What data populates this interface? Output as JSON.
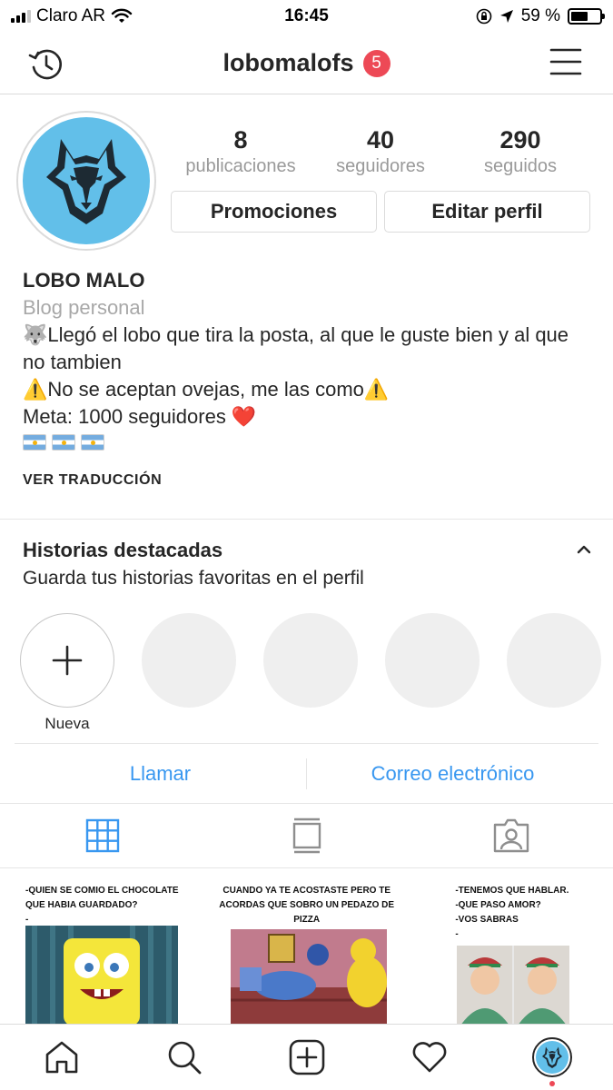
{
  "status_bar": {
    "carrier": "Claro AR",
    "time": "16:45",
    "battery_percent": "59 %",
    "battery_level": 0.59
  },
  "top_nav": {
    "username": "lobomalofs",
    "notification_count": "5",
    "left_icon": "history-icon",
    "right_icon": "menu-icon"
  },
  "profile": {
    "stats": [
      {
        "value": "8",
        "label": "publicaciones"
      },
      {
        "value": "40",
        "label": "seguidores"
      },
      {
        "value": "290",
        "label": "seguidos"
      }
    ],
    "buttons": {
      "promotions": "Promociones",
      "edit": "Editar perfil"
    }
  },
  "bio": {
    "name": "LOBO MALO",
    "category": "Blog personal",
    "line1": "🐺Llegó el lobo que tira la posta, al que le guste bien y al que no tambien",
    "line2": "⚠️No se aceptan ovejas, me las como⚠️",
    "line3": "Meta: 1000 seguidores ❤️",
    "translate": "VER TRADUCCIÓN"
  },
  "highlights": {
    "title": "Historias destacadas",
    "subtitle": "Guarda tus historias favoritas en el perfil",
    "new_label": "Nueva"
  },
  "contact": {
    "call": "Llamar",
    "email": "Correo electrónico"
  },
  "tabs": [
    "grid-icon",
    "feed-icon",
    "tagged-icon"
  ],
  "posts": [
    {
      "caption": "-QUIEN SE COMIO EL CHOCOLATE QUE HABIA GUARDADO?\n-"
    },
    {
      "caption": "CUANDO YA TE ACOSTASTE PERO TE ACORDAS QUE SOBRO UN PEDAZO DE PIZZA"
    },
    {
      "caption": "-TENEMOS QUE HABLAR.\n-QUE PASO AMOR?\n-VOS SABRAS\n-"
    }
  ],
  "bottom_nav": [
    "home-icon",
    "search-icon",
    "add-post-icon",
    "activity-heart-icon",
    "profile-avatar"
  ],
  "colors": {
    "accent_blue": "#3897f0",
    "badge_red": "#ed4956",
    "avatar_bg": "#62bfe9",
    "text": "#262626",
    "muted": "#999999"
  }
}
